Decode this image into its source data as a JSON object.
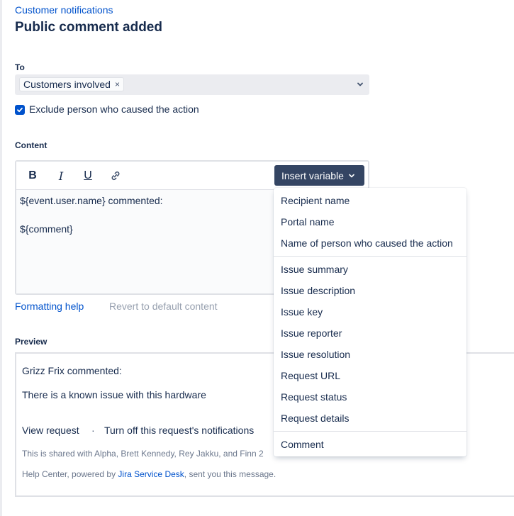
{
  "breadcrumb": "Customer notifications",
  "title": "Public comment added",
  "to": {
    "label": "To",
    "selected_chip": "Customers involved",
    "chip_remove": "×"
  },
  "exclude": {
    "checked": true,
    "label": "Exclude person who caused the action"
  },
  "content": {
    "label": "Content",
    "toolbar": {
      "bold": "B",
      "italic": "I",
      "underline": "U",
      "insert_variable": "Insert variable"
    },
    "lines": [
      "${event.user.name} commented:",
      "${comment}"
    ]
  },
  "links": {
    "formatting_help": "Formatting help",
    "revert": "Revert to default content"
  },
  "preview": {
    "label": "Preview",
    "heading": "Grizz Frix commented:",
    "body": "There is a known issue with this hardware",
    "view_request": "View request",
    "separator": "·",
    "turn_off": "Turn off this request's notifications",
    "shared_with": "This is shared with Alpha, Brett Kennedy, Rey Jakku, and Finn 2",
    "footer_prefix": "Help Center, powered by ",
    "footer_link": "Jira Service Desk",
    "footer_suffix": ", sent you this message."
  },
  "insert_variable_menu": {
    "group1": [
      "Recipient name",
      "Portal name",
      "Name of person who caused the action"
    ],
    "group2": [
      "Issue summary",
      "Issue description",
      "Issue key",
      "Issue reporter",
      "Issue resolution",
      "Request URL",
      "Request status",
      "Request details"
    ],
    "group3": [
      "Comment"
    ]
  },
  "colors": {
    "link": "#0052cc",
    "text": "#172b4d",
    "insert_button_bg": "#344563",
    "checkbox": "#0052cc"
  }
}
